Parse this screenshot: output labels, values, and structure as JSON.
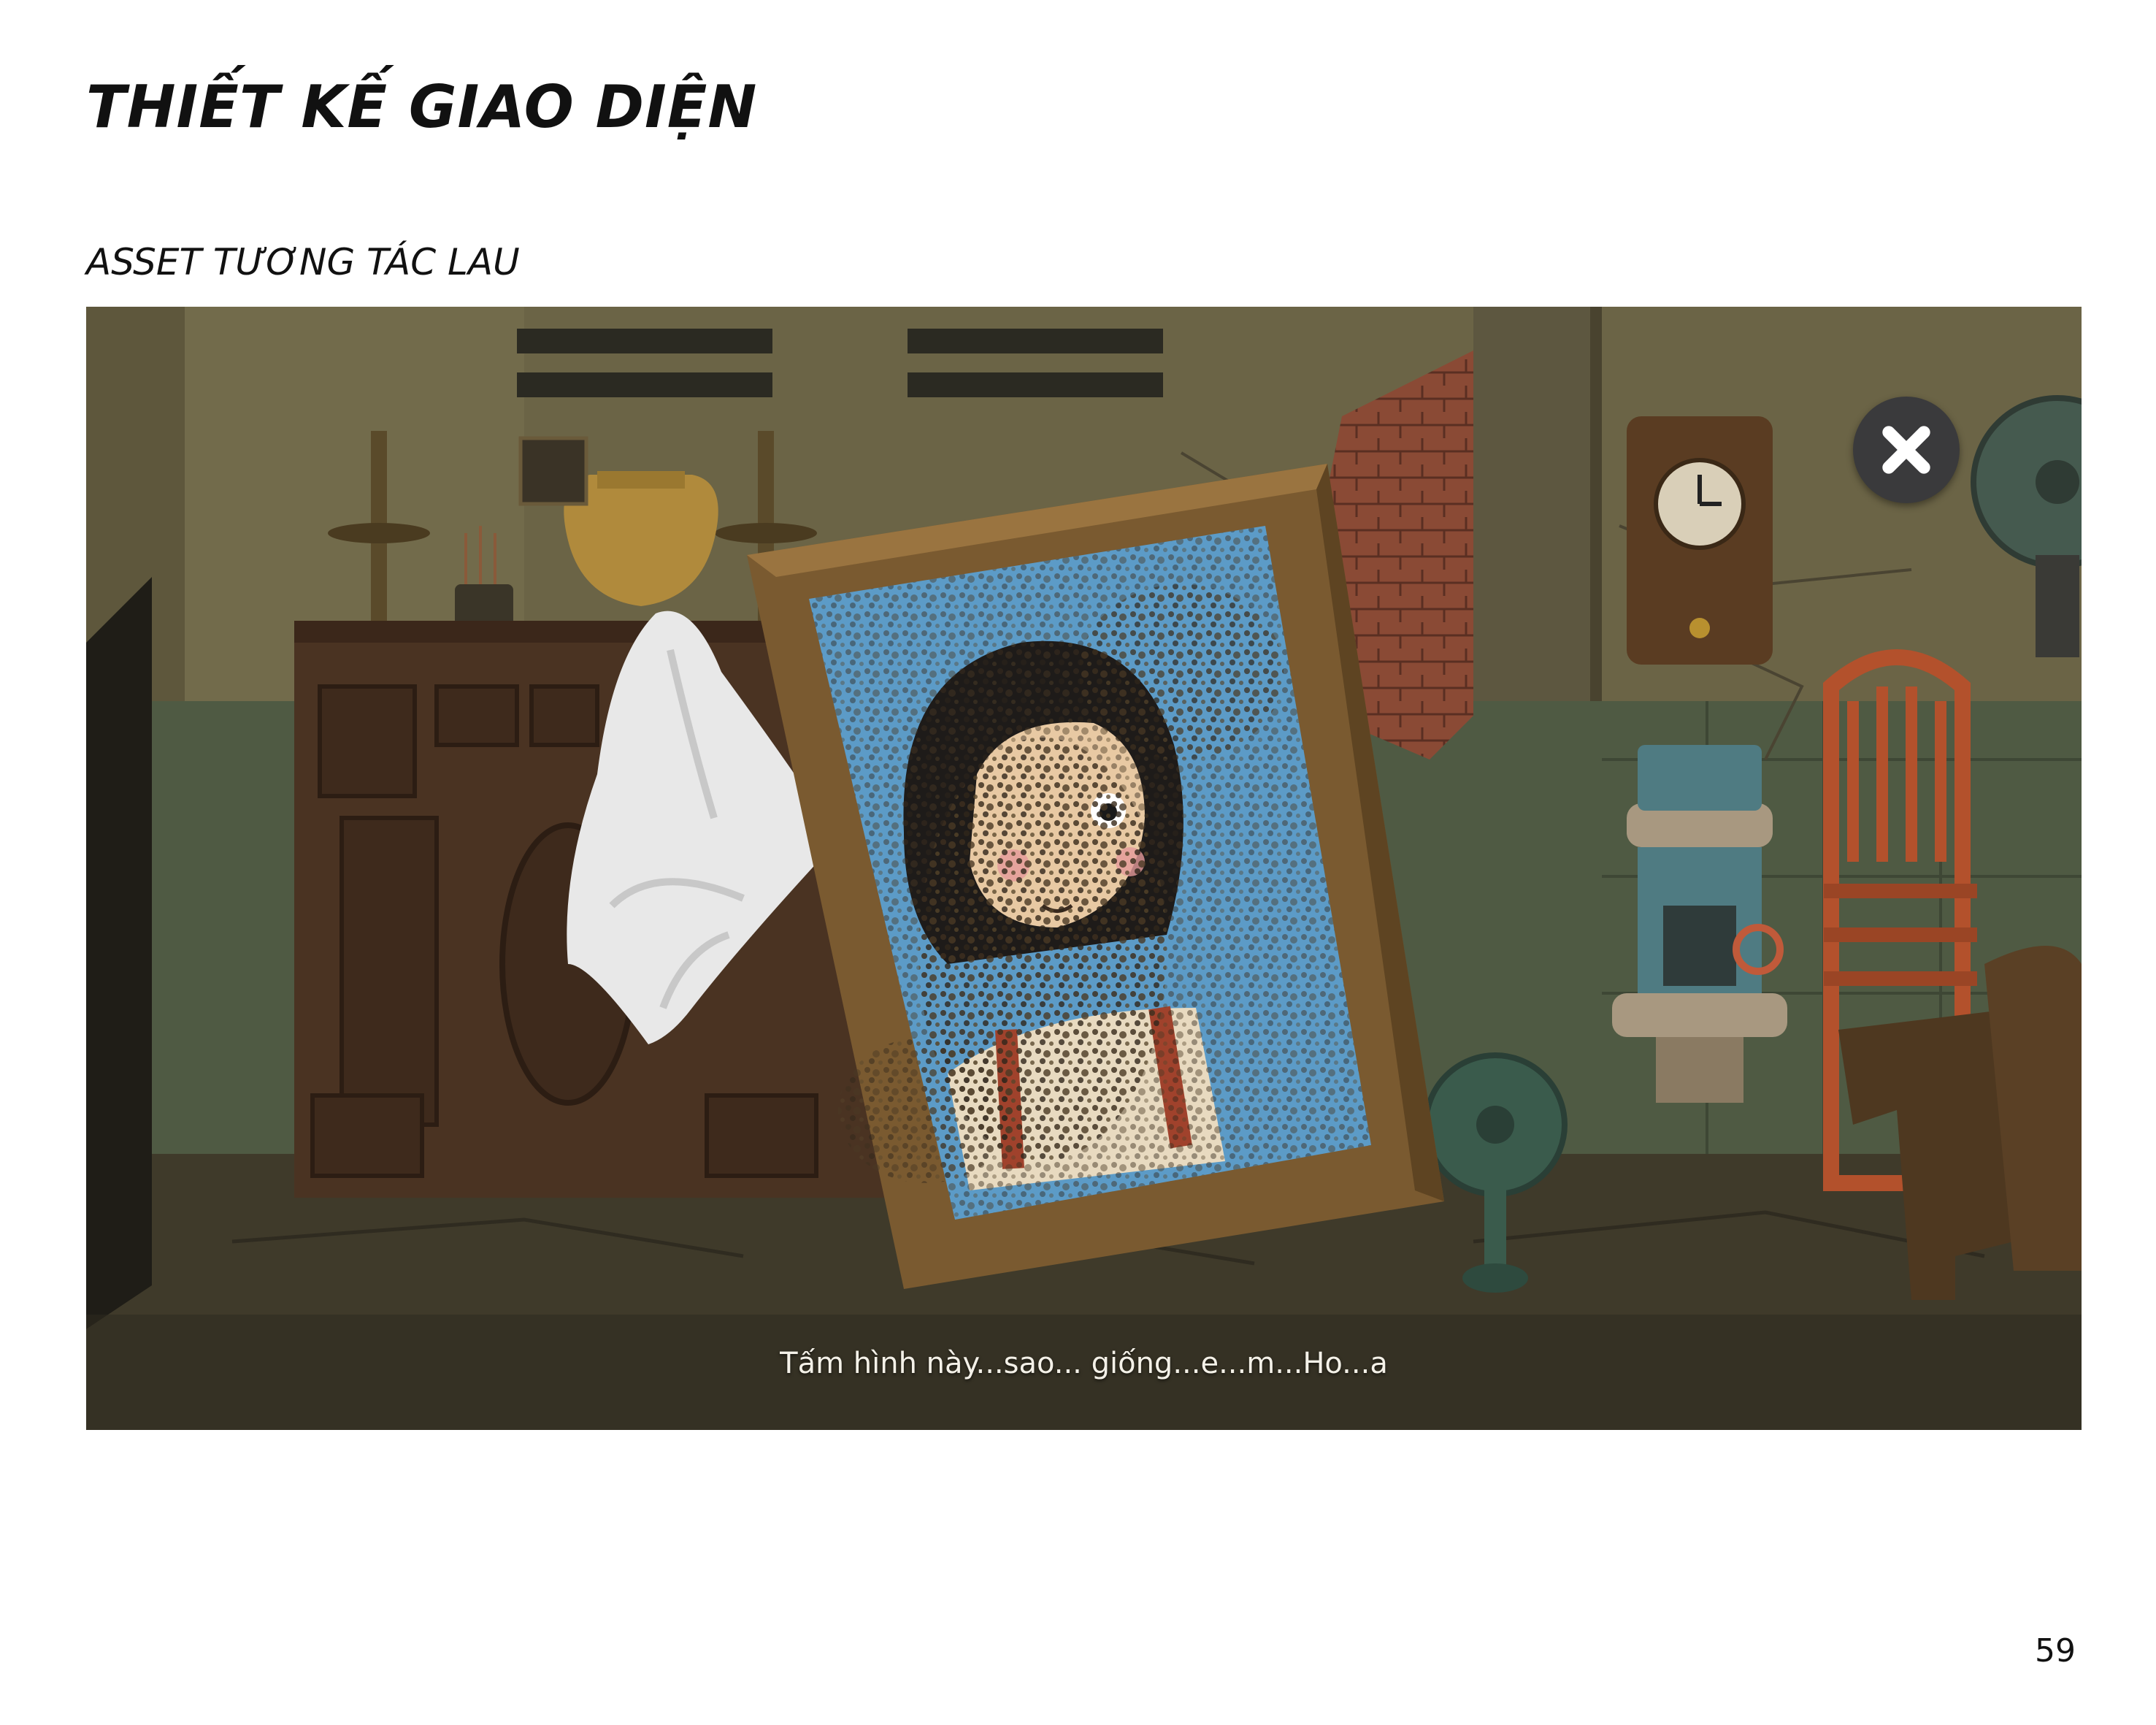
{
  "document": {
    "title": "THIẾT KẾ GIAO DIỆN",
    "section_label": "ASSET TƯƠNG TÁC LAU",
    "page_number": "59"
  },
  "game": {
    "dialogue": "Tấm hình này...sao... giống...e...m...Ho...a",
    "close_icon": "close-x-icon",
    "cloth_icon": "white-cloth-icon",
    "colors": {
      "wall": "#6b6446",
      "wainscot": "#4f5a43",
      "floor": "#3f3a2a",
      "frame_wood": "#7a5a30",
      "photo_bg": "#5c9bc7",
      "dirt": "#4a3a24",
      "close_button": "#3a3a3c"
    }
  }
}
